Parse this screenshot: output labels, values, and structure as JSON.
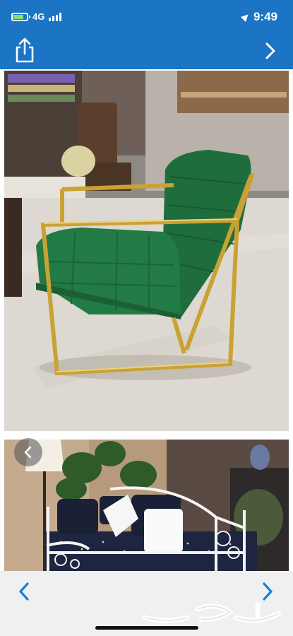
{
  "status_bar": {
    "network": "4G",
    "time": "9:49",
    "battery_color": "#7ee27e"
  },
  "nav": {
    "share_icon": "share-icon",
    "next_icon": "chevron-right-icon"
  },
  "gallery": {
    "photos": [
      {
        "alt": "green-tufted-velvet-chair-gold-frame"
      },
      {
        "alt": "navy-daybed-white-iron-frame-cushions"
      }
    ],
    "prev_icon": "chevron-left-icon"
  },
  "bottom_bar": {
    "prev_icon": "chevron-left-icon",
    "next_icon": "chevron-right-icon",
    "logo": "haraj-logo"
  },
  "colors": {
    "brand_blue": "#1b74c4",
    "accent_blue": "#1a7ed6"
  }
}
